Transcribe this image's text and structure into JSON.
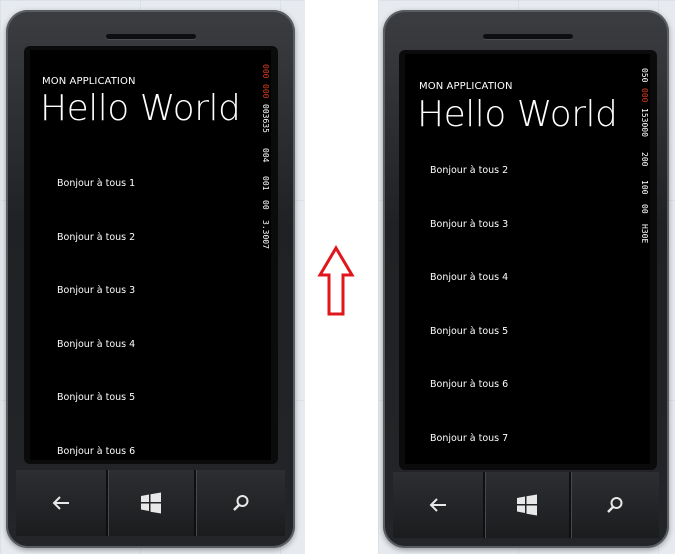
{
  "left_phone": {
    "app_title": "MON APPLICATION",
    "page_title": "Hello World",
    "items": [
      "Bonjour à tous 1",
      "Bonjour à tous 2",
      "Bonjour à tous 3",
      "Bonjour à tous 4",
      "Bonjour à tous 5",
      "Bonjour à tous 6"
    ],
    "counters": [
      {
        "text": "000",
        "color": "red"
      },
      {
        "text": "000",
        "color": "red"
      },
      {
        "text": "003635",
        "color": "white"
      },
      {
        "text": "004",
        "color": "white"
      },
      {
        "text": "001",
        "color": "white"
      },
      {
        "text": "00",
        "color": "white"
      },
      {
        "text": "3.3007",
        "color": "white"
      }
    ]
  },
  "right_phone": {
    "app_title": "MON APPLICATION",
    "page_title": "Hello World",
    "items": [
      "Bonjour à tous 2",
      "Bonjour à tous 3",
      "Bonjour à tous 4",
      "Bonjour à tous 5",
      "Bonjour à tous 6",
      "Bonjour à tous 7"
    ],
    "counters": [
      {
        "text": "050",
        "color": "white"
      },
      {
        "text": "000",
        "color": "red"
      },
      {
        "text": "153000",
        "color": "white"
      },
      {
        "text": "200",
        "color": "white"
      },
      {
        "text": "100",
        "color": "white"
      },
      {
        "text": "00",
        "color": "white"
      },
      {
        "text": "H30E",
        "color": "white"
      }
    ]
  },
  "hardware_buttons": {
    "back_icon": "back-arrow-icon",
    "start_icon": "windows-logo-icon",
    "search_icon": "magnifier-icon"
  },
  "colors": {
    "accent_red": "#d13c1f",
    "arrow_red": "#e0161b",
    "screen_bg": "#000000",
    "text": "#ffffff"
  }
}
